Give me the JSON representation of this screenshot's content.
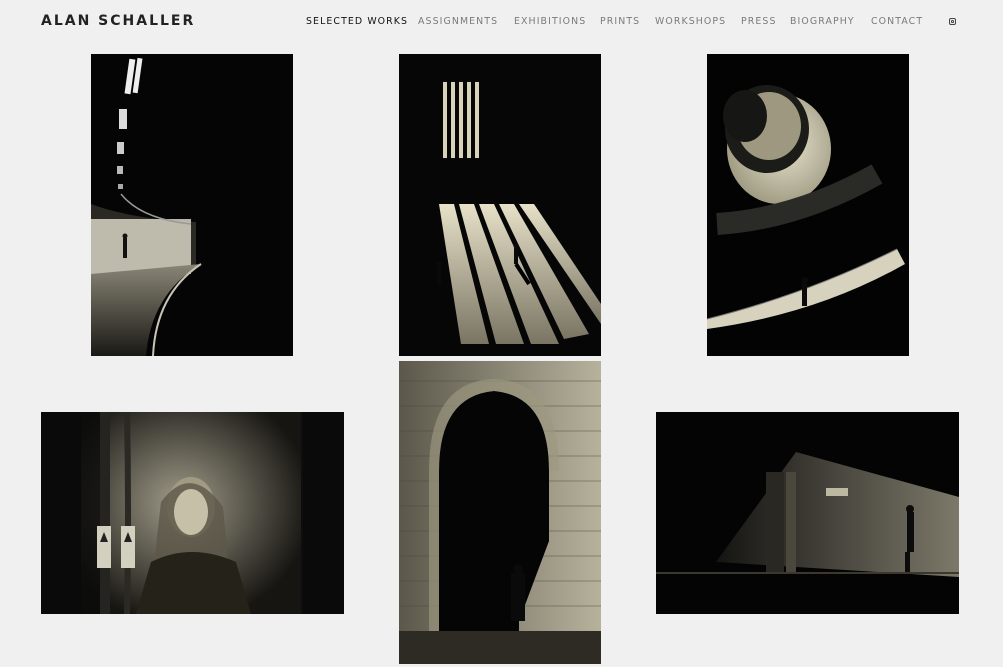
{
  "header": {
    "logo": "ALAN SCHALLER",
    "nav": [
      {
        "label": "SELECTED WORKS",
        "active": true
      },
      {
        "label": "ASSIGNMENTS",
        "active": false
      },
      {
        "label": "EXHIBITIONS",
        "active": false
      },
      {
        "label": "PRINTS",
        "active": false
      },
      {
        "label": "WORKSHOPS",
        "active": false
      },
      {
        "label": "PRESS",
        "active": false
      },
      {
        "label": "BIOGRAPHY",
        "active": false
      },
      {
        "label": "CONTACT",
        "active": false
      }
    ],
    "social_icon": "instagram-icon"
  },
  "gallery": {
    "photos": [
      {
        "subject": "underground-tunnel"
      },
      {
        "subject": "light-window-figures"
      },
      {
        "subject": "spiral-staircase"
      },
      {
        "subject": "woman-train-window"
      },
      {
        "subject": "arched-doorway-man"
      },
      {
        "subject": "street-light-beam"
      }
    ]
  },
  "colors": {
    "background": "#f0f0f0",
    "logo": "#222222",
    "nav_active": "#111111",
    "nav_inactive": "#7a7a7a"
  }
}
